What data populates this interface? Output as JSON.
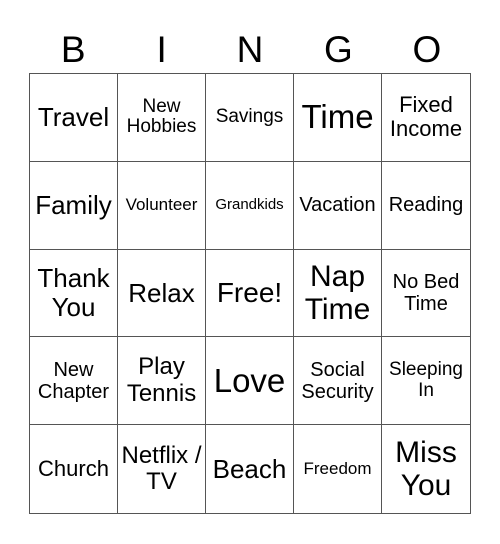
{
  "header": {
    "letters": [
      "B",
      "I",
      "N",
      "G",
      "O"
    ]
  },
  "card": {
    "cells": [
      "Travel",
      "New Hobbies",
      "Savings",
      "Time",
      "Fixed Income",
      "Family",
      "Volunteer",
      "Grandkids",
      "Vacation",
      "Reading",
      "Thank You",
      "Relax",
      "Free!",
      "Nap Time",
      "No Bed Time",
      "New Chapter",
      "Play Tennis",
      "Love",
      "Social Security",
      "Sleeping In",
      "Church",
      "Netflix / TV",
      "Beach",
      "Freedom",
      "Miss You"
    ]
  }
}
